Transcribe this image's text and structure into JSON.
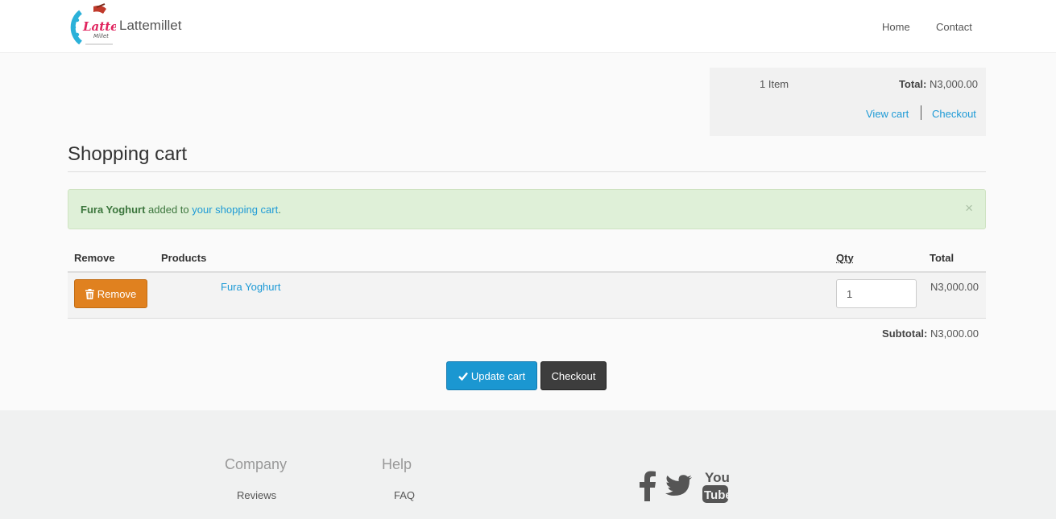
{
  "header": {
    "brand": "Lattemillet",
    "logo_text": "Latte Millet",
    "nav": {
      "home": "Home",
      "contact": "Contact"
    }
  },
  "cart_summary": {
    "count": "1 Item",
    "total_label": "Total:",
    "total_value": "N3,000.00",
    "view_cart": "View cart",
    "checkout": "Checkout"
  },
  "page": {
    "title": "Shopping cart"
  },
  "alert": {
    "product": "Fura Yoghurt",
    "middle": "added to",
    "link": "your shopping cart",
    "end": ".",
    "close": "×"
  },
  "table": {
    "headers": {
      "remove": "Remove",
      "products": "Products",
      "qty": "Qty",
      "total": "Total"
    },
    "rows": [
      {
        "remove_label": "Remove",
        "product": "Fura Yoghurt",
        "qty": "1",
        "total": "N3,000.00"
      }
    ],
    "subtotal_label": "Subtotal:",
    "subtotal_value": "N3,000.00"
  },
  "actions": {
    "update": "Update cart",
    "checkout": "Checkout"
  },
  "footer": {
    "company": {
      "heading": "Company",
      "links": [
        "Reviews"
      ]
    },
    "help": {
      "heading": "Help",
      "links": [
        "FAQ"
      ]
    },
    "social": [
      "facebook-icon",
      "twitter-icon",
      "youtube-icon"
    ]
  },
  "colors": {
    "link": "#1d9ad6",
    "remove_button": "#e0811f",
    "update_button": "#1b97d1",
    "checkout_button": "#3d3d3d",
    "alert_bg": "#dff0d8"
  }
}
